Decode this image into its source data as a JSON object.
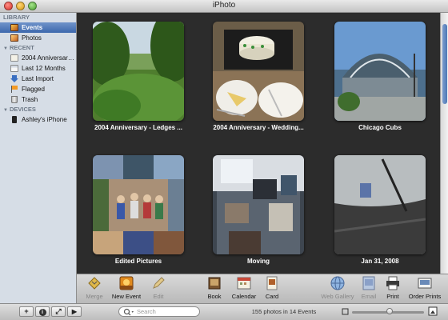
{
  "window": {
    "title": "iPhoto"
  },
  "sidebar": {
    "library_header": "LIBRARY",
    "library_items": [
      {
        "label": "Events",
        "icon": "events-icon",
        "selected": true
      },
      {
        "label": "Photos",
        "icon": "photos-icon"
      }
    ],
    "recent_header": "RECENT",
    "recent_items": [
      {
        "label": "2004 Anniversary ...",
        "icon": "event-icon"
      },
      {
        "label": "Last 12 Months",
        "icon": "calendar-icon"
      },
      {
        "label": "Last Import",
        "icon": "import-icon"
      },
      {
        "label": "Flagged",
        "icon": "flag-icon"
      },
      {
        "label": "Trash",
        "icon": "trash-icon"
      }
    ],
    "devices_header": "DEVICES",
    "device_items": [
      {
        "label": "Ashley's iPhone",
        "icon": "iphone-icon"
      }
    ]
  },
  "events": [
    {
      "caption": "2004 Anniversary - Ledges ...",
      "scene": "forest"
    },
    {
      "caption": "2004 Anniversary - Wedding...",
      "scene": "cake"
    },
    {
      "caption": "Chicago Cubs",
      "scene": "stadium"
    },
    {
      "caption": "Edited Pictures",
      "scene": "collage"
    },
    {
      "caption": "Moving",
      "scene": "room"
    },
    {
      "caption": "Jan 31, 2008",
      "scene": "dashboard"
    }
  ],
  "toolbar": {
    "merge": "Merge",
    "new_event": "New Event",
    "edit": "Edit",
    "book": "Book",
    "calendar": "Calendar",
    "card": "Card",
    "web_gallery": "Web Gallery",
    "email": "Email",
    "print": "Print",
    "order_prints": "Order Prints"
  },
  "bottombar": {
    "add": "+",
    "info": "i",
    "fullscreen": "⤢",
    "play": "▶",
    "search_placeholder": "Search",
    "status": "155 photos in 14 Events",
    "zoom_level": 0.48
  },
  "colors": {
    "selection": "#3d68ad",
    "sidebar_bg": "#d6dde6",
    "main_bg": "#2c2c2c"
  }
}
